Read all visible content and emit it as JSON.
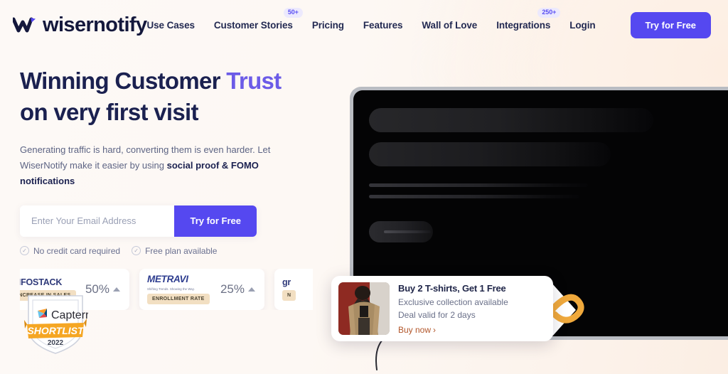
{
  "brand": {
    "name": "wisernotify",
    "logo_icon": "wisernotify-w-mark"
  },
  "nav": {
    "links": [
      {
        "label": "Use Cases",
        "badge": null
      },
      {
        "label": "Customer Stories",
        "badge": "50+"
      },
      {
        "label": "Pricing",
        "badge": null
      },
      {
        "label": "Features",
        "badge": null
      },
      {
        "label": "Wall of Love",
        "badge": null
      },
      {
        "label": "Integrations",
        "badge": "250+"
      },
      {
        "label": "Login",
        "badge": null
      }
    ],
    "cta_label": "Try for Free"
  },
  "hero": {
    "headline_line1_plain": "Winning Customer ",
    "headline_line1_accent": "Trust",
    "headline_line2": "on very first visit",
    "subtitle_part1": "Generating traffic is hard, converting them is even harder. Let WiserNotify make it easier by using ",
    "subtitle_bold": "social proof & FOMO notifications",
    "email_placeholder": "Enter Your Email Address",
    "email_value": "",
    "submit_label": "Try for Free",
    "perks": [
      {
        "label": "No credit card required",
        "icon": "check-circle-icon"
      },
      {
        "label": "Free plan available",
        "icon": "check-circle-icon"
      }
    ]
  },
  "stats": [
    {
      "logo": "INFOSTACK",
      "tagline": "",
      "tag": "INCREASE IN SALES",
      "value": "50%",
      "trend": "up"
    },
    {
      "logo": "METRAVI",
      "tagline": "Shifting Trends. Showing the Way.",
      "tag": "ENROLLMENT RATE",
      "value": "25%",
      "trend": "up"
    },
    {
      "logo": "gr",
      "tagline": "",
      "tag": "N",
      "value": "",
      "trend": "up"
    }
  ],
  "award": {
    "brand": "Capterra",
    "title": "SHORTLIST",
    "year": "2022",
    "icon": "capterra-badge-icon"
  },
  "notification": {
    "title": "Buy 2 T-shirts, Get 1 Free",
    "line1": "Exclusive collection available",
    "line2": "Deal valid for 2 days",
    "link_label": "Buy now",
    "link_chevron": "›",
    "thumb_icon": "product-photo-thumbnail",
    "tag_icon": "price-tag-icon"
  },
  "colors": {
    "accent_purple": "#5548f0",
    "heading_navy": "#1b2150",
    "tag_peach": "#f2dfc2",
    "link_orange": "#b2562a",
    "badge_lavender": "#ece9fd"
  }
}
